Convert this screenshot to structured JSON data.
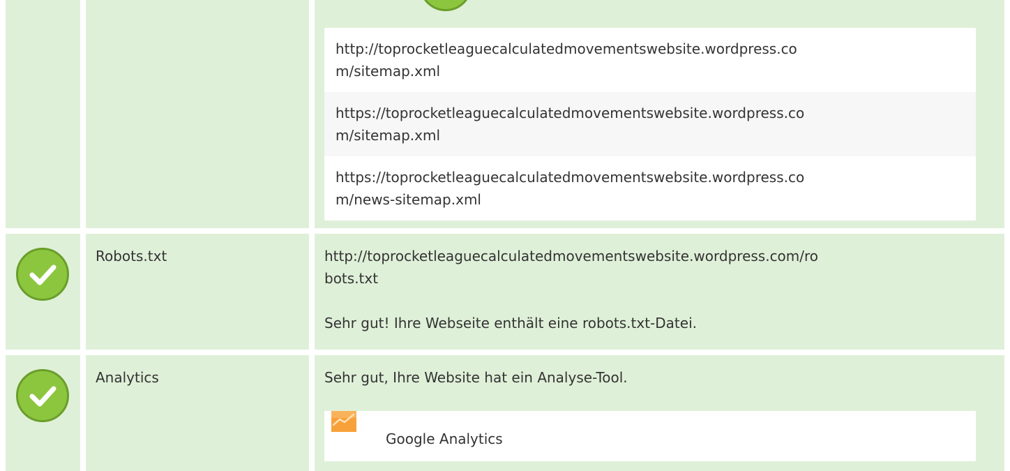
{
  "sitemaps": {
    "items": [
      "http://toprocketleaguecalculatedmovementswebsite.wordpress.co\nm/sitemap.xml",
      "https://toprocketleaguecalculatedmovementswebsite.wordpress.co\nm/sitemap.xml",
      "https://toprocketleaguecalculatedmovementswebsite.wordpress.co\nm/news-sitemap.xml"
    ]
  },
  "robots": {
    "label": "Robots.txt",
    "url": "http://toprocketleaguecalculatedmovementswebsite.wordpress.com/ro\nbots.txt",
    "message": "Sehr gut! Ihre Webseite enthält eine robots.txt-Datei."
  },
  "analytics": {
    "label": "Analytics",
    "message": "Sehr gut, Ihre Website hat ein Analyse-Tool.",
    "tool_name": "Google Analytics",
    "tool_icon": "google-analytics-icon"
  },
  "colors": {
    "row_bg": "#dff0d8",
    "check_green": "#8cc63f",
    "ga_orange": "#f7a13a"
  }
}
